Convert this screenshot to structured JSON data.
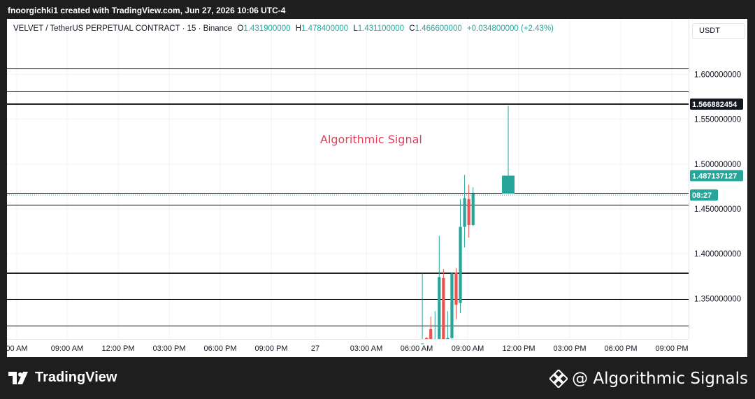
{
  "caption": "fnoorgichki1 created with TradingView.com, Jun 27, 2026 10:06 UTC-4",
  "legend": {
    "symbol": "VELVET / TetherUS PERPETUAL CONTRACT · 15 · Binance",
    "o_label": "O",
    "o_value": "1.431900000",
    "h_label": "H",
    "h_value": "1.478400000",
    "l_label": "L",
    "l_value": "1.431100000",
    "c_label": "C",
    "c_value": "1.466600000",
    "change": "+0.034800000 (+2.43%)"
  },
  "currency_button": "USDT",
  "annotation": "Algorithmic Signal",
  "footer": {
    "brand": "TradingView",
    "watermark": "@ Algorithmic Signals"
  },
  "colors": {
    "up": "#26a69a",
    "down": "#ef5350",
    "annotation": "#e0405a",
    "level_line": "#000000"
  },
  "chart_data": {
    "type": "candlestick",
    "x_ticks": [
      "00 AM",
      "09:00 AM",
      "12:00 PM",
      "03:00 PM",
      "06:00 PM",
      "09:00 PM",
      "27",
      "03:00 AM",
      "06:00 AM",
      "09:00 AM",
      "12:00 PM",
      "03:00 PM",
      "06:00 PM",
      "09:00 PM"
    ],
    "y_ticks": [
      "1.600000000",
      "1.550000000",
      "1.500000000",
      "1.450000000",
      "1.400000000",
      "1.350000000"
    ],
    "y_tick_values": [
      1.6,
      1.55,
      1.5,
      1.45,
      1.4,
      1.35
    ],
    "ylim": [
      1.305,
      1.662
    ],
    "horizontal_levels": [
      {
        "price": 1.607,
        "weight": 1
      },
      {
        "price": 1.582,
        "weight": 1
      },
      {
        "price": 1.5669,
        "weight": 2
      },
      {
        "price": 1.4677,
        "weight": 1
      },
      {
        "price": 1.4545,
        "weight": 1
      },
      {
        "price": 1.3785,
        "weight": 2
      },
      {
        "price": 1.3495,
        "weight": 1
      },
      {
        "price": 1.3195,
        "weight": 1
      }
    ],
    "dotted_level": 1.4655,
    "price_tags": [
      {
        "text": "1.566882454",
        "price": 1.5669,
        "kind": "dark"
      },
      {
        "text": "1.487137127",
        "price": 1.4871,
        "kind": "green"
      },
      {
        "text": "08:27",
        "price": 1.4655,
        "kind": "green"
      }
    ],
    "candles": [
      {
        "o": 1.3,
        "h": 1.378,
        "l": 1.3,
        "c": 1.3
      },
      {
        "o": 1.306,
        "h": 1.307,
        "l": 1.3,
        "c": 1.304
      },
      {
        "o": 1.316,
        "h": 1.33,
        "l": 1.3,
        "c": 1.305
      },
      {
        "o": 1.305,
        "h": 1.336,
        "l": 1.3,
        "c": 1.305
      },
      {
        "o": 1.304,
        "h": 1.42,
        "l": 1.3,
        "c": 1.374
      },
      {
        "o": 1.373,
        "h": 1.383,
        "l": 1.3,
        "c": 1.303
      },
      {
        "o": 1.305,
        "h": 1.336,
        "l": 1.3,
        "c": 1.306
      },
      {
        "o": 1.306,
        "h": 1.379,
        "l": 1.3,
        "c": 1.378
      },
      {
        "o": 1.379,
        "h": 1.384,
        "l": 1.327,
        "c": 1.343
      },
      {
        "o": 1.345,
        "h": 1.461,
        "l": 1.334,
        "c": 1.43
      },
      {
        "o": 1.43,
        "h": 1.488,
        "l": 1.407,
        "c": 1.462
      },
      {
        "o": 1.461,
        "h": 1.477,
        "l": 1.418,
        "c": 1.432
      },
      {
        "o": 1.432,
        "h": 1.474,
        "l": 1.431,
        "c": 1.467
      },
      {
        "o": 1.4671,
        "h": 1.5649,
        "l": 1.4666,
        "c": 1.4871
      }
    ]
  }
}
